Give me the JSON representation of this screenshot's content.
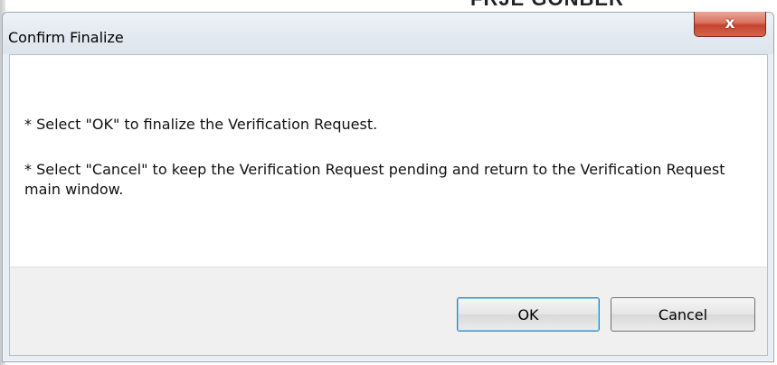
{
  "background": {
    "partial_text": "FRJE GONBER"
  },
  "dialog": {
    "title": "Confirm Finalize",
    "close_label": "x",
    "messages": [
      "* Select \"OK\" to finalize the Verification Request.",
      "* Select \"Cancel\" to keep the Verification Request pending and return to the Verification Request main window."
    ],
    "buttons": {
      "ok": "OK",
      "cancel": "Cancel"
    }
  },
  "colors": {
    "close_button": "#c4442e",
    "default_button_border": "#3c7fb1",
    "footer_bg": "#f0f0f0"
  }
}
